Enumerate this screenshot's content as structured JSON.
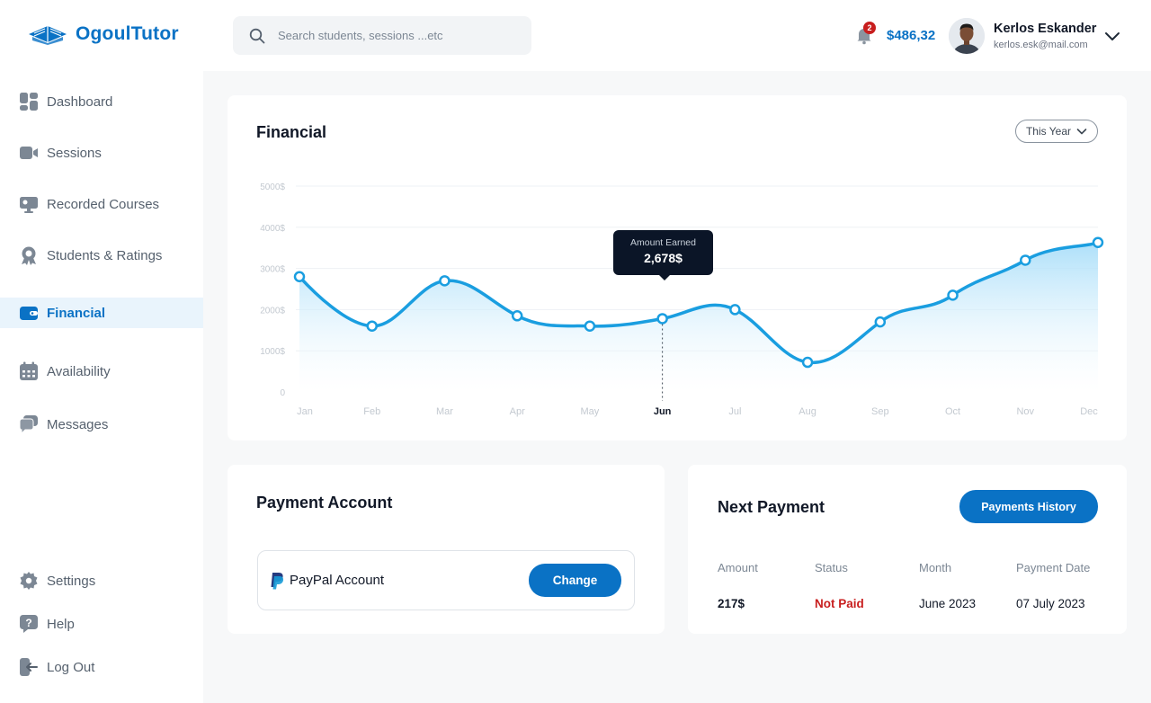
{
  "app": {
    "brand": "OgoulTutor"
  },
  "search": {
    "placeholder": "Search students, sessions ...etc"
  },
  "header": {
    "notification_count": "2",
    "balance": "$486,32",
    "user_name": "Kerlos Eskander",
    "user_email": "kerlos.esk@mail.com"
  },
  "sidebar": {
    "items": [
      {
        "label": "Dashboard",
        "icon": "dashboard-icon"
      },
      {
        "label": "Sessions",
        "icon": "video-camera-icon"
      },
      {
        "label": "Recorded Courses",
        "icon": "monitor-icon"
      },
      {
        "label": "Students & Ratings",
        "icon": "award-badge-icon"
      },
      {
        "label": "Financial",
        "icon": "wallet-icon",
        "active": true
      },
      {
        "label": "Availability",
        "icon": "calendar-icon"
      },
      {
        "label": "Messages",
        "icon": "chat-bubble-icon"
      }
    ],
    "bottom_items": [
      {
        "label": "Settings",
        "icon": "gear-icon"
      },
      {
        "label": "Help",
        "icon": "help-icon"
      },
      {
        "label": "Log Out",
        "icon": "logout-icon"
      }
    ]
  },
  "financial": {
    "title": "Financial",
    "period": "This Year",
    "tooltip_label": "Amount Earned",
    "tooltip_value": "2,678$"
  },
  "chart_data": {
    "type": "area",
    "categories": [
      "Jan",
      "Feb",
      "Mar",
      "Apr",
      "May",
      "Jun",
      "Jul",
      "Aug",
      "Sep",
      "Oct",
      "Nov",
      "Dec"
    ],
    "highlighted_category": "Jun",
    "y_tick_labels": [
      "5000$",
      "4000$",
      "3000$",
      "2000$",
      "1000$",
      "0"
    ],
    "ylim": [
      0,
      5000
    ],
    "grid": true,
    "series": [
      {
        "values": [
          2800,
          1600,
          2700,
          1850,
          1600,
          1780,
          2000,
          720,
          1700,
          2350,
          3200,
          3630
        ]
      }
    ],
    "colors": {
      "line": "#1a9ee0",
      "fill": "#bfe6fb"
    }
  },
  "payment_account": {
    "title": "Payment Account",
    "account_label": "PayPal Account",
    "change_label": "Change"
  },
  "next_payment": {
    "title": "Next Payment",
    "history_button": "Payments History",
    "headers": [
      "Amount",
      "Status",
      "Month",
      "Payment Date"
    ],
    "row": [
      "217$",
      "Not Paid",
      "June 2023",
      "07 July 2023"
    ],
    "status_color": "#c81e1e"
  }
}
